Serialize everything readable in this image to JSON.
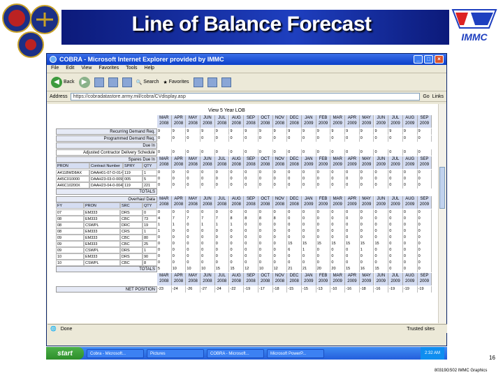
{
  "slide": {
    "title": "Line of Balance Forecast",
    "page_number": "16",
    "footer": "80319GS02 IMMC Graphics",
    "right_logo_text": "IMMC"
  },
  "browser": {
    "window_title": "COBRA - Microsoft Internet Explorer provided by IMMC",
    "menu": [
      "File",
      "Edit",
      "View",
      "Favorites",
      "Tools",
      "Help"
    ],
    "toolbar": {
      "back": "Back",
      "search": "Search",
      "favorites": "Favorites"
    },
    "address_label": "Address",
    "address_value": "https://cobradatastore.army.mil/cobra/CVdisplay.asp",
    "go_label": "Go",
    "links_label": "Links",
    "status_left": "Done",
    "status_right": "Trusted sites"
  },
  "page": {
    "heading": "View 5 Year LOB",
    "months": [
      "MAR\n2008",
      "APR\n2008",
      "MAY\n2008",
      "JUN\n2008",
      "JUL\n2008",
      "AUG\n2008",
      "SEP\n2008",
      "OCT\n2008",
      "NOV\n2008",
      "DEC\n2008",
      "JAN\n2009",
      "FEB\n2009",
      "MAR\n2009",
      "APR\n2009",
      "MAY\n2009",
      "JUN\n2009",
      "JUL\n2009",
      "AUG\n2009",
      "SEP\n2009"
    ],
    "recurring_label": "Recurring Demand Req.",
    "programmed_label": "Programmed Demand Req.",
    "due_in_label": "Due In",
    "adjusted_label": "Adjusted Contractor Delivery Schedule",
    "spares_label": "Spares Due In",
    "spares_cols": [
      "PRON",
      "Contract Number",
      "SPRY",
      "QTY"
    ],
    "spares_rows": [
      [
        "A4118WD8AX",
        "DAAH01-07-D-0149",
        "119",
        "1"
      ],
      [
        "A45C010000",
        "DAAH23-03-0-0098",
        "005",
        "5"
      ],
      [
        "A46C10200X",
        "DAAH23-04-0-0048",
        "119",
        "221"
      ]
    ],
    "totals_label": "TOTALS",
    "overhaul_label": "Overhaul Data",
    "overhaul_cols": [
      "FY",
      "PRON",
      "SRC",
      "QTY"
    ],
    "overhaul_rows": [
      [
        "07",
        "EM333",
        "DRS",
        "0"
      ],
      [
        "08",
        "EM333",
        "CBC",
        "73"
      ],
      [
        "08",
        "CSWPL",
        "DRC",
        "19"
      ],
      [
        "08",
        "EM333",
        "CRS",
        "1"
      ],
      [
        "09",
        "EM333",
        "CBC",
        "80"
      ],
      [
        "09",
        "EM333",
        "CBC",
        "25"
      ],
      [
        "09",
        "CSWPL",
        "DRS",
        "1"
      ],
      [
        "10",
        "EM333",
        "DRS",
        "90"
      ],
      [
        "10",
        "CSWPL",
        "CBC",
        "8"
      ]
    ],
    "totals2_label": "TOTALS",
    "net_position_label": "NET POSITION",
    "recurring_values": [
      "9",
      "9",
      "9",
      "9",
      "9",
      "9",
      "9",
      "9",
      "9",
      "9",
      "9",
      "9",
      "9",
      "9",
      "9",
      "9",
      "9",
      "9",
      "9"
    ],
    "programmed_values": [
      "0",
      "0",
      "0",
      "0",
      "0",
      "0",
      "0",
      "0",
      "0",
      "0",
      "0",
      "0",
      "0",
      "0",
      "0",
      "0",
      "0",
      "0",
      "0"
    ],
    "adjusted_values": [
      "0",
      "0",
      "0",
      "0",
      "0",
      "0",
      "0",
      "0",
      "0",
      "0",
      "0",
      "0",
      "0",
      "0",
      "0",
      "0",
      "0",
      "0",
      "0"
    ],
    "overhaul_values": [
      [
        "0",
        "0",
        "0",
        "0",
        "0",
        "0",
        "0",
        "0",
        "0",
        "0",
        "0",
        "0",
        "0",
        "0",
        "0",
        "0",
        "0",
        "0",
        "0"
      ],
      [
        "4",
        "7",
        "7",
        "7",
        "7",
        "8",
        "8",
        "8",
        "8",
        "0",
        "0",
        "0",
        "0",
        "0",
        "0",
        "0",
        "0",
        "0",
        "0"
      ],
      [
        "1",
        "1",
        "0",
        "1",
        "1",
        "1",
        "0",
        "0",
        "0",
        "0",
        "0",
        "0",
        "0",
        "0",
        "0",
        "0",
        "0",
        "0",
        "0"
      ],
      [
        "1",
        "0",
        "0",
        "0",
        "0",
        "0",
        "0",
        "0",
        "0",
        "0",
        "0",
        "0",
        "0",
        "0",
        "0",
        "0",
        "0",
        "0",
        "0"
      ],
      [
        "0",
        "0",
        "0",
        "0",
        "0",
        "0",
        "0",
        "0",
        "0",
        "0",
        "0",
        "0",
        "0",
        "0",
        "0",
        "0",
        "0",
        "0",
        "0"
      ],
      [
        "0",
        "0",
        "0",
        "0",
        "0",
        "0",
        "0",
        "0",
        "0",
        "15",
        "15",
        "15",
        "15",
        "15",
        "15",
        "15",
        "0",
        "0",
        "0"
      ],
      [
        "0",
        "0",
        "0",
        "0",
        "0",
        "0",
        "0",
        "0",
        "0",
        "6",
        "1",
        "0",
        "0",
        "0",
        "1",
        "0",
        "0",
        "0",
        "0"
      ],
      [
        "0",
        "0",
        "0",
        "0",
        "0",
        "0",
        "0",
        "0",
        "0",
        "0",
        "0",
        "0",
        "0",
        "0",
        "0",
        "0",
        "0",
        "0",
        "0"
      ],
      [
        "0",
        "0",
        "0",
        "0",
        "0",
        "0",
        "0",
        "0",
        "0",
        "0",
        "0",
        "0",
        "0",
        "0",
        "0",
        "0",
        "0",
        "0",
        "0"
      ]
    ],
    "totals2_values": [
      "5",
      "10",
      "10",
      "10",
      "15",
      "15",
      "12",
      "10",
      "12",
      "21",
      "21",
      "20",
      "20",
      "15",
      "16",
      "15",
      "0",
      "0",
      "0"
    ],
    "net_values": [
      "-23",
      "-24",
      "-26",
      "-27",
      "-24",
      "-22",
      "-19",
      "-17",
      "-18",
      "-15",
      "-15",
      "-13",
      "-10",
      "-16",
      "-18",
      "-16",
      "-19",
      "-19",
      "-19"
    ]
  },
  "taskbar": {
    "start": "start",
    "tasks": [
      "Cobra - Microsoft...",
      "Pictures",
      "COBRA - Microsoft...",
      "Microsoft PowerP..."
    ],
    "clock": "2:32 AM"
  }
}
